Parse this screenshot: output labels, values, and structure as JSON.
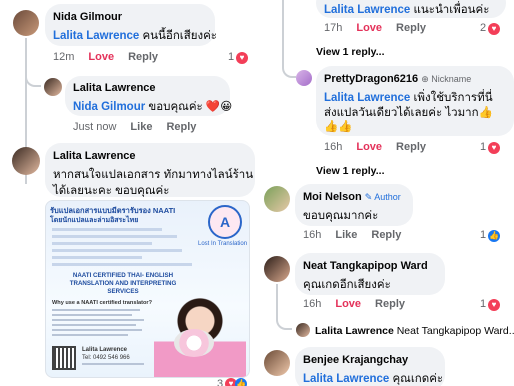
{
  "left": {
    "c1": {
      "author": "Nida Gilmour",
      "mention": "Lalita Lawrence",
      "text": " คนนี้อีกเสียงค่ะ",
      "time": "12m",
      "love": "Love",
      "reply": "Reply",
      "count": "1"
    },
    "c2": {
      "author": "Lalita Lawrence",
      "mention": "Nida Gilmour",
      "text": " ขอบคุณค่ะ ❤️😀",
      "time": "Just now",
      "like": "Like",
      "reply": "Reply"
    },
    "c3": {
      "author": "Lalita Lawrence",
      "line1": "หากสนใจแปลเอกสาร ทักมาทางไลน์ร้าน",
      "line2": "ได้เลยนะคะ ขอบคุณค่ะ",
      "count": "3"
    },
    "flyer": {
      "title": "รับแปลเอกสารแบบมีตรารับรอง NAATI",
      "subtitle": "โดยนักแปลและล่ามอิสระไทย",
      "block_title": "NAATI CERTIFIED THAI- ENGLISH TRANSLATION AND INTERPRETING SERVICES",
      "why": "Why use a NAATI certified translator?",
      "contact_name": "Lalita Lawrence",
      "phone": "Tel: 0492 546 966",
      "brand": "Lost In Translation"
    }
  },
  "right": {
    "top": {
      "mention": "Lalita Lawrence",
      "text": " แนะนำเพื่อนค่ะ",
      "time": "17h",
      "love": "Love",
      "reply": "Reply",
      "count": "2"
    },
    "view1": "View 1 reply...",
    "c_pd": {
      "author": "PrettyDragon6216",
      "badge": "Nickname",
      "mention": "Lalita Lawrence",
      "line1": " เพิ่งใช้บริการที่นี่",
      "line2": "ส่งแปลวันเดียวได้เลยค่ะ ไวมาก👍",
      "line3": "👍👍",
      "time": "16h",
      "love": "Love",
      "reply": "Reply",
      "count": "1"
    },
    "view2": "View 1 reply...",
    "c_moi": {
      "author": "Moi Nelson",
      "badge": "Author",
      "text": "ขอบคุณมากค่ะ",
      "time": "16h",
      "like": "Like",
      "reply": "Reply",
      "count": "1"
    },
    "c_neat": {
      "author": "Neat Tangkapipop Ward",
      "text": "คุณเกดอีกเสียงค่ะ",
      "time": "16h",
      "love": "Love",
      "reply": "Reply",
      "count": "1"
    },
    "reply_preview": {
      "author": "Lalita Lawrence",
      "text": "Neat Tangkapipop Ward..."
    },
    "c_benjee": {
      "author": "Benjee Krajangchay",
      "mention": "Lalita Lawrence",
      "text": " คุณเกดค่ะ"
    }
  }
}
